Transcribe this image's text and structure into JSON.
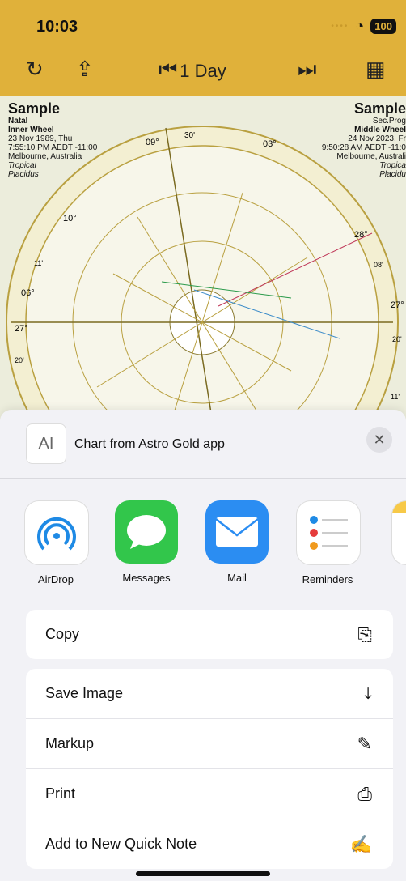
{
  "status_bar": {
    "time": "10:03",
    "battery": "100"
  },
  "toolbar": {
    "title": "1 Day",
    "refresh_icon": "↻",
    "share_icon": "⇪",
    "prev_icon": "⏮",
    "next_icon": "⏭",
    "grid_icon": "▦"
  },
  "chart": {
    "left": {
      "title": "Sample",
      "type": "Natal",
      "wheel": "Inner Wheel",
      "date": "23 Nov 1989, Thu",
      "time": "7:55:10 PM AEDT -11:00",
      "place": "Melbourne, Australia",
      "zodiac": "Tropical",
      "houses": "Placidus"
    },
    "right": {
      "title": "Sample",
      "type": "Sec.Prog",
      "wheel": "Middle Wheel",
      "date": "24 Nov 2023, Fr",
      "time": "9:50:28 AM AEDT -11:0",
      "place": "Melbourne, Australi",
      "zodiac": "Tropica",
      "houses": "Placidu"
    },
    "labels": {
      "top_left": "09°",
      "top_right": "03°",
      "top_30": "30'",
      "right_28": "28°",
      "left_27": "27°",
      "right_27": "27°",
      "left_06": "06°",
      "left_10": "10°",
      "left_11": "11'",
      "left_20": "20'",
      "right_08": "08'",
      "right_20": "20'",
      "right_11": "11'"
    }
  },
  "share_sheet": {
    "preview_glyph": "AI",
    "title": "Chart from Astro Gold app",
    "close_icon": "✕",
    "apps": [
      {
        "label": "AirDrop"
      },
      {
        "label": "Messages"
      },
      {
        "label": "Mail"
      },
      {
        "label": "Reminders"
      }
    ],
    "copy": {
      "label": "Copy",
      "icon": "⎘"
    },
    "actions": [
      {
        "label": "Save Image",
        "icon": "⤓"
      },
      {
        "label": "Markup",
        "icon": "✎"
      },
      {
        "label": "Print",
        "icon": "⎙"
      },
      {
        "label": "Add to New Quick Note",
        "icon": "✍"
      }
    ]
  }
}
